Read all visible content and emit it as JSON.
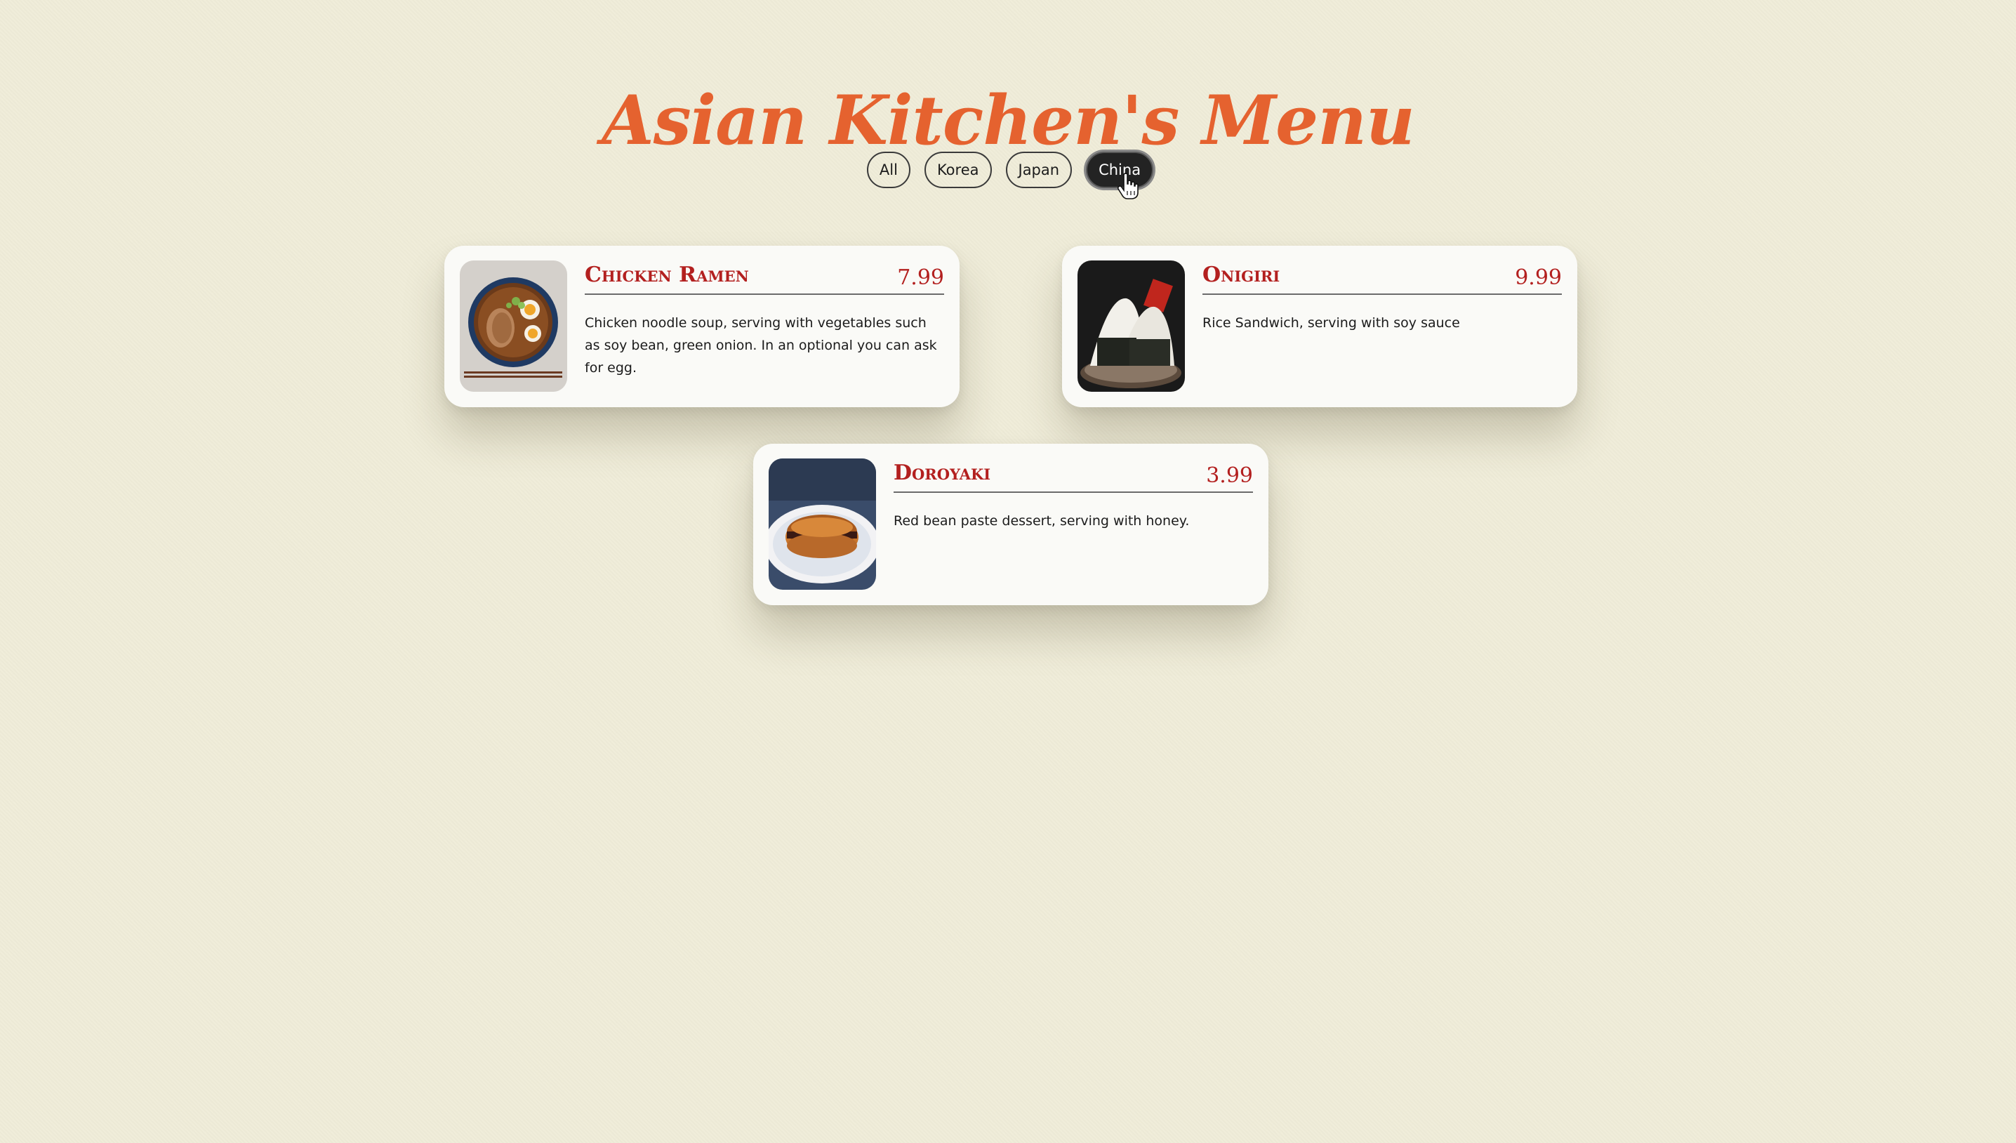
{
  "header": {
    "title": "Asian Kitchen's Menu"
  },
  "filters": [
    {
      "label": "All",
      "active": false
    },
    {
      "label": "Korea",
      "active": false
    },
    {
      "label": "Japan",
      "active": false
    },
    {
      "label": "China",
      "active": true
    }
  ],
  "menu_items": [
    {
      "name": "Chicken Ramen",
      "price": "7.99",
      "description": "Chicken noodle soup, serving with vegetables such as soy bean, green onion. In an optional you can ask for egg.",
      "image_icon": "ramen-bowl-photo"
    },
    {
      "name": "Onigiri",
      "price": "9.99",
      "description": "Rice Sandwich, serving with soy sauce",
      "image_icon": "onigiri-photo"
    },
    {
      "name": "Doroyaki",
      "price": "3.99",
      "description": "Red bean paste dessert, serving with honey.",
      "image_icon": "dorayaki-photo"
    }
  ],
  "colors": {
    "background": "#efecd8",
    "title": "#e5622f",
    "item_name": "#b3201f",
    "active_filter": "#232323"
  }
}
